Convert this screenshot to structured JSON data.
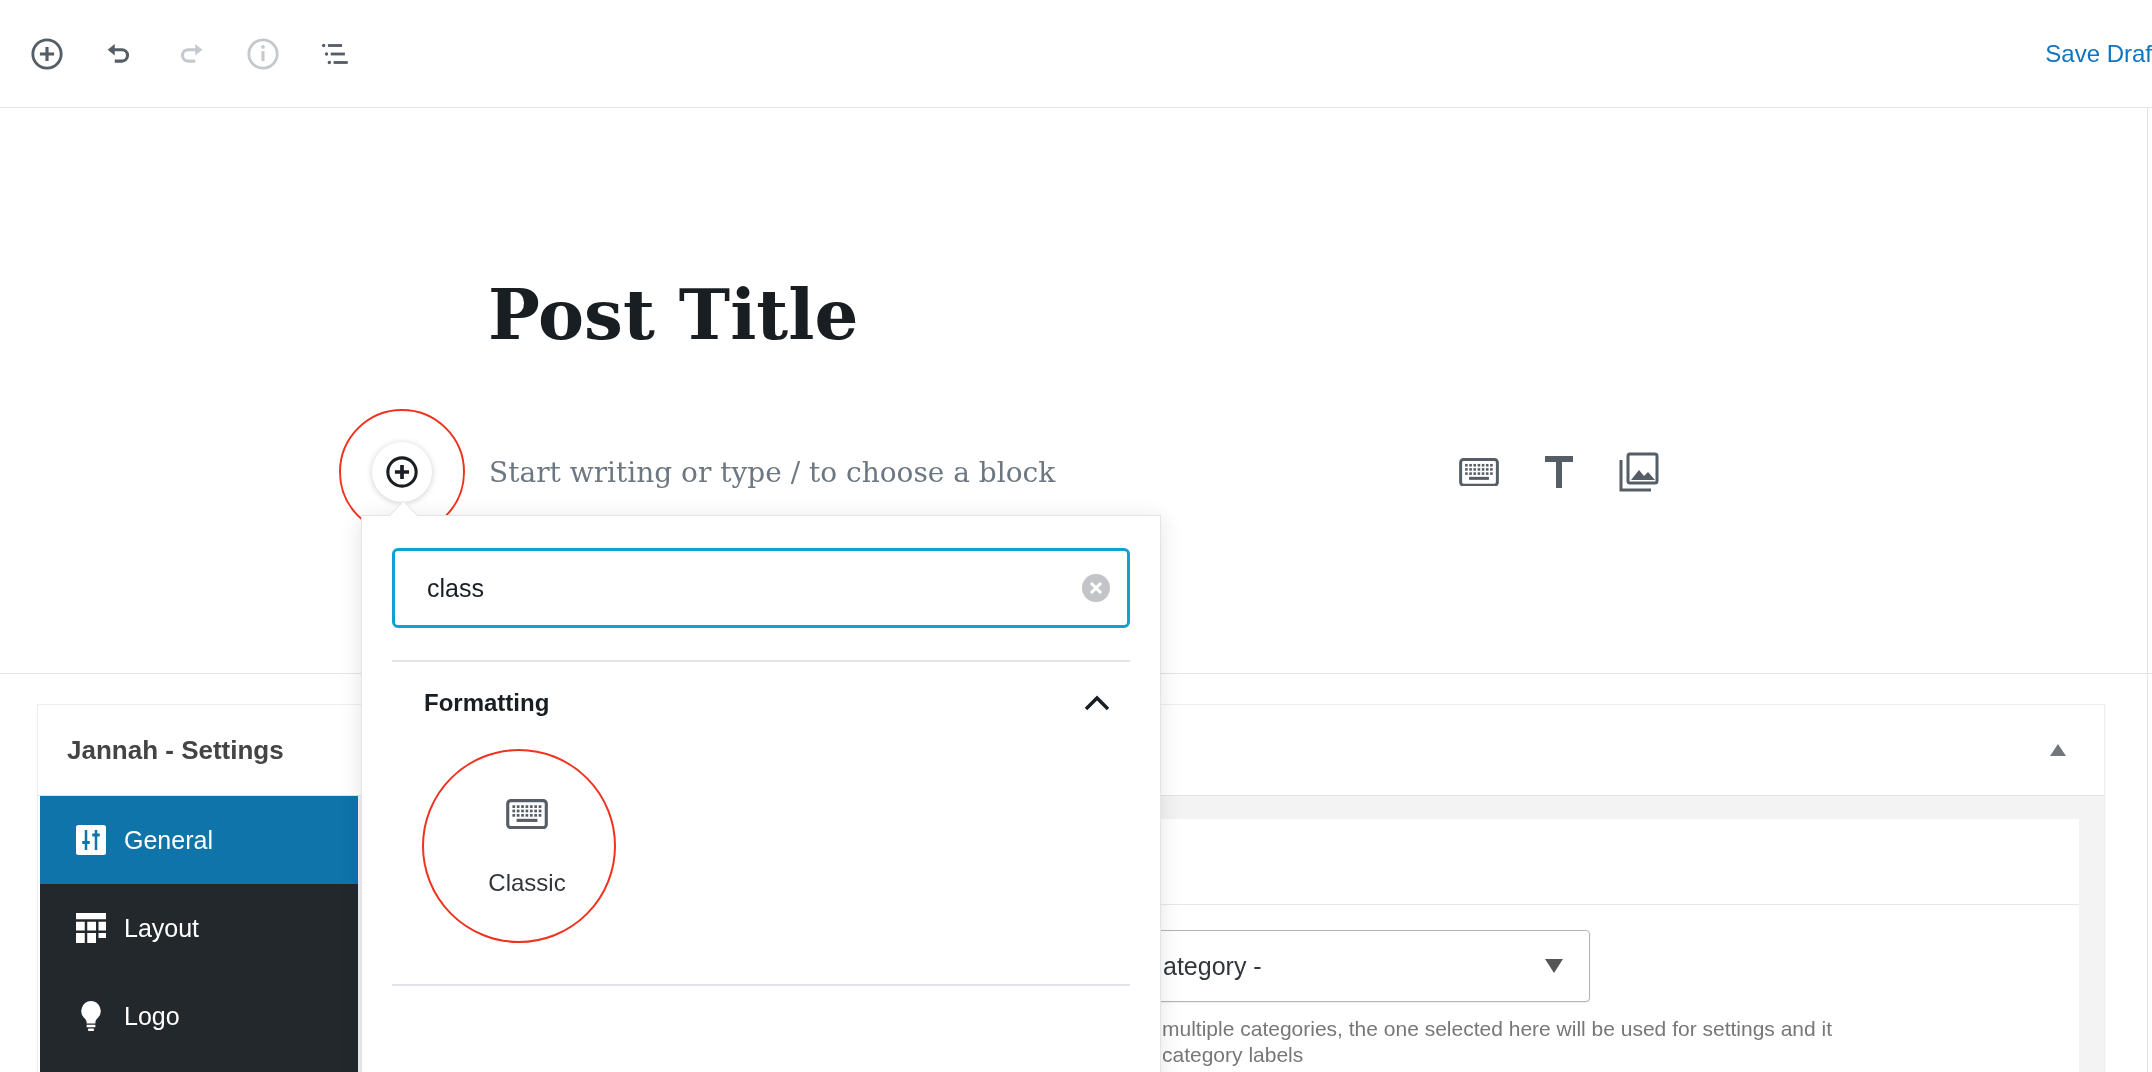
{
  "toolbar": [
    {
      "disabled": false
    },
    {
      "disabled": false
    },
    {
      "disabled": true
    },
    {
      "disabled": true
    },
    {
      "disabled": false
    }
  ],
  "save_button": "Save Draf",
  "post": {
    "title": "Post Title",
    "placeholder": "Start writing or type / to choose a block",
    "inserter_highlighted": true
  },
  "inserter": {
    "search": {
      "value": "class"
    },
    "categories": [
      {
        "title": "Formatting",
        "expanded": true,
        "blocks": [
          {
            "label": "Classic",
            "highlighted": true
          }
        ]
      }
    ]
  },
  "settings_box": {
    "title": "Jannah - Settings",
    "expanded": true,
    "sidebar": [
      {
        "label": "General",
        "selected": true
      },
      {
        "label": "Layout",
        "selected": false
      },
      {
        "label": "Logo",
        "selected": false
      }
    ],
    "category_select": {
      "value": "ategory -"
    },
    "description": [
      "multiple categories, the one selected here will be used for settings and it",
      "category labels"
    ]
  }
}
